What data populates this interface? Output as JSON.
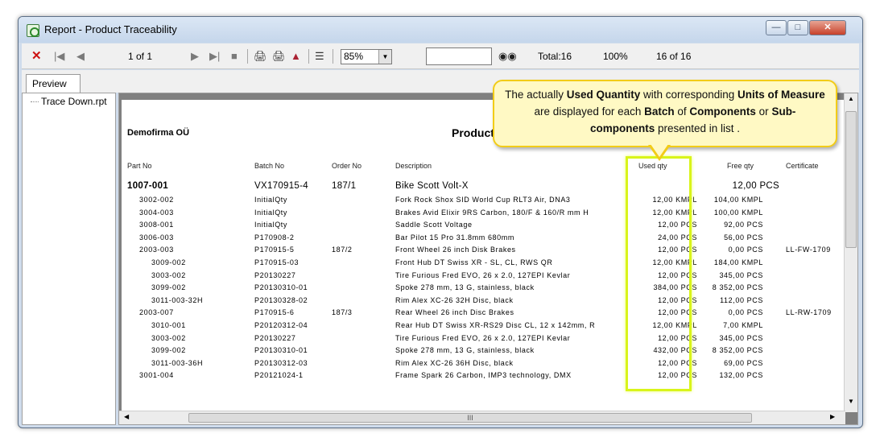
{
  "window": {
    "title": "Report - Product Traceability"
  },
  "toolbar": {
    "page_text": "1 of 1",
    "zoom": "85%",
    "total": "Total:16",
    "percent": "100%",
    "record": "16 of 16"
  },
  "tabs": {
    "preview": "Preview"
  },
  "tree": {
    "item": "Trace Down.rpt"
  },
  "report": {
    "company": "Demofirma OÜ",
    "title": "Product Traceability",
    "columns": {
      "part_no": "Part No",
      "batch_no": "Batch No",
      "order_no": "Order No",
      "description": "Description",
      "used_qty": "Used qty",
      "free_qty": "Free qty",
      "certificate": "Certificate"
    },
    "rows": [
      {
        "level": 0,
        "part": "1007-001",
        "batch": "VX170915-4",
        "order": "187/1",
        "desc": "Bike Scott Volt-X",
        "used": "",
        "free": "12,00 PCS",
        "cert": ""
      },
      {
        "level": 1,
        "part": "3002-002",
        "batch": "InitialQty",
        "order": "",
        "desc": "Fork Rock Shox SID World Cup RLT3 Air, DNA3",
        "used": "12,00 KMPL",
        "free": "104,00 KMPL",
        "cert": ""
      },
      {
        "level": 1,
        "part": "3004-003",
        "batch": "InitialQty",
        "order": "",
        "desc": "Brakes Avid Elixir 9RS Carbon, 180/F & 160/R mm H",
        "used": "12,00 KMPL",
        "free": "100,00 KMPL",
        "cert": ""
      },
      {
        "level": 1,
        "part": "3008-001",
        "batch": "InitialQty",
        "order": "",
        "desc": "Saddle Scott Voltage",
        "used": "12,00 PCS",
        "free": "92,00 PCS",
        "cert": ""
      },
      {
        "level": 1,
        "part": "3006-003",
        "batch": "P170908-2",
        "order": "",
        "desc": "Bar Pilot 15 Pro 31.8mm 680mm",
        "used": "24,00 PCS",
        "free": "56,00 PCS",
        "cert": ""
      },
      {
        "level": 1,
        "part": "2003-003",
        "batch": "P170915-5",
        "order": "187/2",
        "desc": "Front Wheel 26 inch Disk Brakes",
        "used": "12,00 PCS",
        "free": "0,00 PCS",
        "cert": "LL-FW-1709"
      },
      {
        "level": 2,
        "part": "3009-002",
        "batch": "P170915-03",
        "order": "",
        "desc": "Front Hub DT Swiss XR - SL, CL, RWS QR",
        "used": "12,00 KMPL",
        "free": "184,00 KMPL",
        "cert": ""
      },
      {
        "level": 2,
        "part": "3003-002",
        "batch": "P20130227",
        "order": "",
        "desc": "Tire Furious Fred EVO, 26 x 2.0, 127EPI Kevlar",
        "used": "12,00 PCS",
        "free": "345,00 PCS",
        "cert": ""
      },
      {
        "level": 2,
        "part": "3099-002",
        "batch": "P20130310-01",
        "order": "",
        "desc": "Spoke 278 mm, 13 G, stainless, black",
        "used": "384,00 PCS",
        "free": "8 352,00 PCS",
        "cert": ""
      },
      {
        "level": 2,
        "part": "3011-003-32H",
        "batch": "P20130328-02",
        "order": "",
        "desc": "Rim Alex XC-26 32H Disc, black",
        "used": "12,00 PCS",
        "free": "112,00 PCS",
        "cert": ""
      },
      {
        "level": 1,
        "part": "2003-007",
        "batch": "P170915-6",
        "order": "187/3",
        "desc": "Rear Wheel 26 inch Disc Brakes",
        "used": "12,00 PCS",
        "free": "0,00 PCS",
        "cert": "LL-RW-1709"
      },
      {
        "level": 2,
        "part": "3010-001",
        "batch": "P20120312-04",
        "order": "",
        "desc": "Rear Hub DT Swiss XR-RS29 Disc CL, 12 x 142mm, R",
        "used": "12,00 KMPL",
        "free": "7,00 KMPL",
        "cert": ""
      },
      {
        "level": 2,
        "part": "3003-002",
        "batch": "P20130227",
        "order": "",
        "desc": "Tire Furious Fred EVO, 26 x 2.0, 127EPI Kevlar",
        "used": "12,00 PCS",
        "free": "345,00 PCS",
        "cert": ""
      },
      {
        "level": 2,
        "part": "3099-002",
        "batch": "P20130310-01",
        "order": "",
        "desc": "Spoke 278 mm, 13 G, stainless, black",
        "used": "432,00 PCS",
        "free": "8 352,00 PCS",
        "cert": ""
      },
      {
        "level": 2,
        "part": "3011-003-36H",
        "batch": "P20130312-03",
        "order": "",
        "desc": "Rim Alex XC-26 36H Disc, black",
        "used": "12,00 PCS",
        "free": "69,00 PCS",
        "cert": ""
      },
      {
        "level": 1,
        "part": "3001-004",
        "batch": "P20121024-1",
        "order": "",
        "desc": "Frame Spark 26 Carbon, IMP3 technology, DMX",
        "used": "12,00 PCS",
        "free": "132,00 PCS",
        "cert": ""
      }
    ]
  },
  "callout": {
    "t1": "The actually ",
    "b1": "Used Quantity",
    "t2": " with corresponding ",
    "b2": "Units of Measure",
    "t3": " are displayed for each ",
    "b3": "Batch",
    "t4": " of ",
    "b4": "Components",
    "t5": " or ",
    "b5": "Sub-components",
    "t6": " presented in list ."
  },
  "scrollbar": {
    "grip": "III"
  },
  "colors": {
    "highlight": "#d9f41a",
    "callout_bg": "#fff9c4",
    "callout_border": "#f2cc18",
    "close_red": "#cc1111"
  }
}
